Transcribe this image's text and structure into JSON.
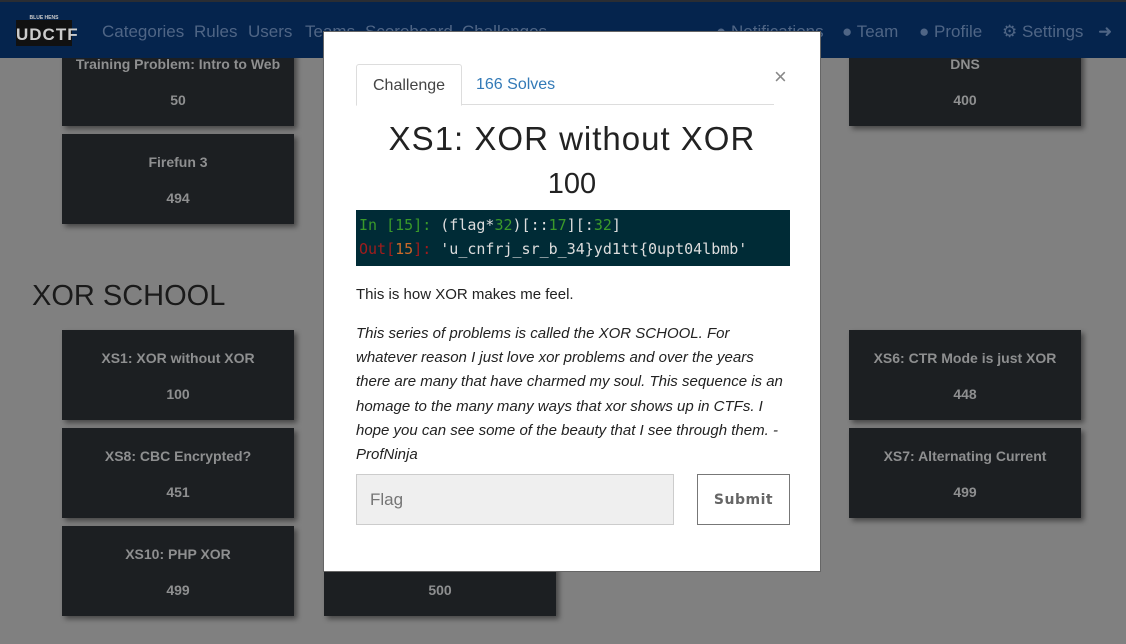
{
  "nav": {
    "logo": "UDCTF",
    "logo_sub": "BLUE HENS",
    "links": [
      "Categories",
      "Rules",
      "Users",
      "Teams",
      "Scoreboard",
      "Challenges"
    ],
    "right": [
      "Notifications",
      "Team",
      "Profile",
      "Settings"
    ]
  },
  "cards_top": [
    {
      "name": "Training Problem: Intro to Web",
      "points": "50"
    },
    {
      "name": "DNS",
      "points": "400"
    },
    {
      "name": "Firefun 3",
      "points": "494"
    }
  ],
  "section": "XOR SCHOOL",
  "cards_xor": [
    {
      "name": "XS1: XOR without XOR",
      "points": "100"
    },
    {
      "name": "XS6: CTR Mode is just XOR",
      "points": "448"
    },
    {
      "name": "XS8: CBC Encrypted?",
      "points": "451"
    },
    {
      "name": "XS7: Alternating Current",
      "points": "499"
    },
    {
      "name": "XS10: PHP XOR",
      "points": "499"
    },
    {
      "name": "",
      "points": "500"
    }
  ],
  "modal": {
    "tab_challenge": "Challenge",
    "tab_solves": "166 Solves",
    "close": "×",
    "title": "XS1: XOR without XOR",
    "value": "100",
    "code": {
      "in_label": "In [",
      "in_num": "15",
      "in_close": "]: ",
      "in_expr_a": "(flag*",
      "n32": "32",
      "in_expr_b": ")[::",
      "n17": "17",
      "in_expr_c": "][:",
      "in_expr_d": "]",
      "out_label": "Out[",
      "out_num": "15",
      "out_close": "]: ",
      "out_val": "'u_cnfrj_sr_b_34}yd1tt{0upt04lbmb'"
    },
    "p1": "This is how XOR makes me feel.",
    "p2": "This series of problems is called the XOR SCHOOL. For whatever reason I just love xor problems and over the years there are many that have charmed my soul. This sequence is an homage to the many many ways that xor shows up in CTFs. I hope you can see some of the beauty that I see through them. -ProfNinja",
    "flag_placeholder": "Flag",
    "submit": "Submit"
  }
}
